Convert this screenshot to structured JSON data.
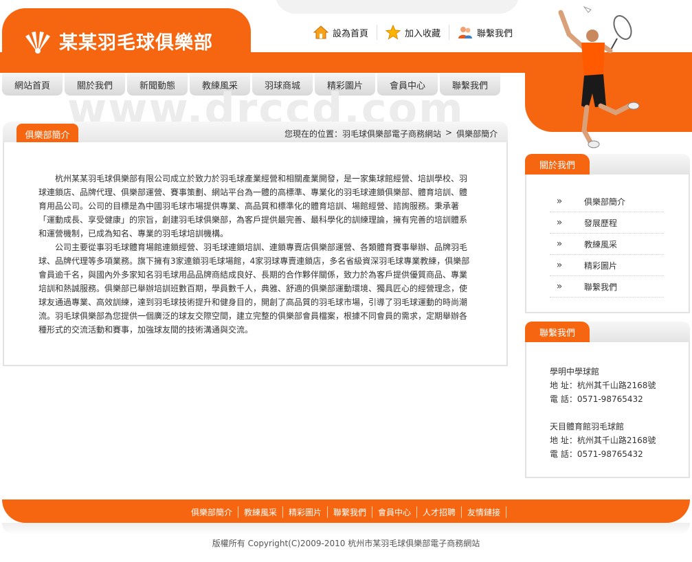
{
  "site": {
    "logo_text": "某某羽毛球俱樂部",
    "watermark": "www.drccd.com"
  },
  "toplinks": [
    {
      "label": "設為首頁",
      "icon": "home-icon"
    },
    {
      "label": "加入收藏",
      "icon": "star-icon"
    },
    {
      "label": "聯繫我們",
      "icon": "users-icon"
    }
  ],
  "nav": [
    "網站首頁",
    "關於我們",
    "新聞動態",
    "教練風采",
    "羽球商城",
    "精彩圖片",
    "會員中心",
    "聯繫我們"
  ],
  "main": {
    "tab": "俱樂部簡介",
    "breadcrumb": {
      "prefix": "您現在的位置：羽毛球俱樂部電子商務網站",
      "sep": ">",
      "current": "俱樂部簡介"
    },
    "paragraphs": [
      "杭州某某羽毛球俱樂部有限公司成立於致力於羽毛球產業經營和相關產業開發，是一家集球館經營、培訓學校、羽球連鎖店、品牌代理、俱樂部運營、賽事策劃、網站平台為一體的高標準、專業化的羽毛球連鎖俱樂部、體育培訓、體育用品公司。公司的目標是為中國羽毛球市場提供專業、高品質和標準化的體育培訓、場館經營、諮詢服務。秉承著「運動成長、享受健康」的宗旨，創建羽毛球俱樂部，為客戶提供最完善、最科學化的訓練理論，擁有完善的培訓體系和運營機制，已成為知名、專業的羽毛球培訓機構。",
      "公司主要從事羽毛球體育場館連鎖經營、羽毛球連鎖培訓、連鎖專賣店俱樂部運營、各類體育賽事舉辦、品牌羽毛球、品牌代理等多項業務。旗下擁有3家連鎖羽毛球場館，4家羽球專賣連鎖店，多名省級資深羽毛球專業教練，俱樂部會員逾千名，與國內外多家知名羽毛球用品品牌商結成良好、長期的合作夥伴關係，致力於為客戶提供優質商品、專業培訓和熱誠服務。俱樂部已舉辦培訓班數百期，學員數千人，典雅、舒適的俱樂部運動環境、獨具匠心的經營理念，使球友通過專業、高效訓練，達到羽毛球技術提升和健身目的，開創了高品質的羽毛球市場，引導了羽毛球運動的時尚潮流。羽毛球俱樂部為您提供一個廣泛的球友交際空間，建立完整的俱樂部會員檔案，根據不同會員的需求，定期舉辦各種形式的交流活動和賽事，加強球友間的技術溝通與交流。"
    ]
  },
  "about": {
    "title": "關於我們",
    "items": [
      "俱樂部簡介",
      "發展歷程",
      "教練風采",
      "精彩圖片",
      "聯繫我們"
    ],
    "arrow": "»"
  },
  "contact": {
    "title": "聯繫我們",
    "venues": [
      {
        "name": "學明中學球館",
        "address": "地 址：杭州其千山路2168號",
        "phone": "電 話：0571-98765432"
      },
      {
        "name": "天目體育館羽毛球館",
        "address": "地 址：杭州其千山路2168號",
        "phone": "電 話：0571-98765432"
      }
    ]
  },
  "footer": {
    "links": [
      "俱樂部簡介",
      "教練風采",
      "精彩圖片",
      "聯繫我們",
      "會員中心",
      "人才招聘",
      "友情鏈接"
    ],
    "copyright": "版權所有 Copyright(C)2009-2010 杭州市某羽毛球俱樂部電子商務網站"
  },
  "colors": {
    "brand": "#f6650f",
    "nav_bg": "#e0e0e0"
  }
}
